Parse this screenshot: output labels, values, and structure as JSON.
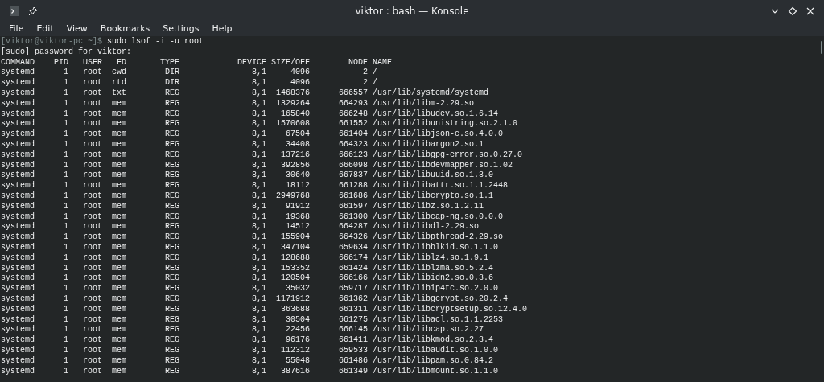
{
  "window": {
    "title": "viktor : bash — Konsole"
  },
  "menu": [
    "File",
    "Edit",
    "View",
    "Bookmarks",
    "Settings",
    "Help"
  ],
  "terminal": {
    "prompt": "[viktor@viktor-pc ~]$",
    "command": "sudo lsof -i -u root",
    "message": "[sudo] password for viktor:",
    "columns": [
      "COMMAND",
      "PID",
      "USER",
      "FD",
      "TYPE",
      "DEVICE",
      "SIZE/OFF",
      "NODE",
      "NAME"
    ],
    "rows": [
      [
        "systemd",
        "1",
        "root",
        "cwd",
        "DIR",
        "8,1",
        "4096",
        "2",
        "/"
      ],
      [
        "systemd",
        "1",
        "root",
        "rtd",
        "DIR",
        "8,1",
        "4096",
        "2",
        "/"
      ],
      [
        "systemd",
        "1",
        "root",
        "txt",
        "REG",
        "8,1",
        "1468376",
        "666557",
        "/usr/lib/systemd/systemd"
      ],
      [
        "systemd",
        "1",
        "root",
        "mem",
        "REG",
        "8,1",
        "1329264",
        "664293",
        "/usr/lib/libm-2.29.so"
      ],
      [
        "systemd",
        "1",
        "root",
        "mem",
        "REG",
        "8,1",
        "165840",
        "666248",
        "/usr/lib/libudev.so.1.6.14"
      ],
      [
        "systemd",
        "1",
        "root",
        "mem",
        "REG",
        "8,1",
        "1570608",
        "661552",
        "/usr/lib/libunistring.so.2.1.0"
      ],
      [
        "systemd",
        "1",
        "root",
        "mem",
        "REG",
        "8,1",
        "67504",
        "661404",
        "/usr/lib/libjson-c.so.4.0.0"
      ],
      [
        "systemd",
        "1",
        "root",
        "mem",
        "REG",
        "8,1",
        "34408",
        "664323",
        "/usr/lib/libargon2.so.1"
      ],
      [
        "systemd",
        "1",
        "root",
        "mem",
        "REG",
        "8,1",
        "137216",
        "666123",
        "/usr/lib/libgpg-error.so.0.27.0"
      ],
      [
        "systemd",
        "1",
        "root",
        "mem",
        "REG",
        "8,1",
        "392856",
        "666098",
        "/usr/lib/libdevmapper.so.1.02"
      ],
      [
        "systemd",
        "1",
        "root",
        "mem",
        "REG",
        "8,1",
        "30640",
        "667837",
        "/usr/lib/libuuid.so.1.3.0"
      ],
      [
        "systemd",
        "1",
        "root",
        "mem",
        "REG",
        "8,1",
        "18112",
        "661288",
        "/usr/lib/libattr.so.1.1.2448"
      ],
      [
        "systemd",
        "1",
        "root",
        "mem",
        "REG",
        "8,1",
        "2949768",
        "661686",
        "/usr/lib/libcrypto.so.1.1"
      ],
      [
        "systemd",
        "1",
        "root",
        "mem",
        "REG",
        "8,1",
        "91912",
        "661597",
        "/usr/lib/libz.so.1.2.11"
      ],
      [
        "systemd",
        "1",
        "root",
        "mem",
        "REG",
        "8,1",
        "19368",
        "661300",
        "/usr/lib/libcap-ng.so.0.0.0"
      ],
      [
        "systemd",
        "1",
        "root",
        "mem",
        "REG",
        "8,1",
        "14512",
        "664287",
        "/usr/lib/libdl-2.29.so"
      ],
      [
        "systemd",
        "1",
        "root",
        "mem",
        "REG",
        "8,1",
        "155904",
        "664326",
        "/usr/lib/libpthread-2.29.so"
      ],
      [
        "systemd",
        "1",
        "root",
        "mem",
        "REG",
        "8,1",
        "347104",
        "659634",
        "/usr/lib/libblkid.so.1.1.0"
      ],
      [
        "systemd",
        "1",
        "root",
        "mem",
        "REG",
        "8,1",
        "128688",
        "666174",
        "/usr/lib/liblz4.so.1.9.1"
      ],
      [
        "systemd",
        "1",
        "root",
        "mem",
        "REG",
        "8,1",
        "153352",
        "661424",
        "/usr/lib/liblzma.so.5.2.4"
      ],
      [
        "systemd",
        "1",
        "root",
        "mem",
        "REG",
        "8,1",
        "120504",
        "666166",
        "/usr/lib/libidn2.so.0.3.6"
      ],
      [
        "systemd",
        "1",
        "root",
        "mem",
        "REG",
        "8,1",
        "35032",
        "659717",
        "/usr/lib/libip4tc.so.2.0.0"
      ],
      [
        "systemd",
        "1",
        "root",
        "mem",
        "REG",
        "8,1",
        "1171912",
        "661362",
        "/usr/lib/libgcrypt.so.20.2.4"
      ],
      [
        "systemd",
        "1",
        "root",
        "mem",
        "REG",
        "8,1",
        "363688",
        "661311",
        "/usr/lib/libcryptsetup.so.12.4.0"
      ],
      [
        "systemd",
        "1",
        "root",
        "mem",
        "REG",
        "8,1",
        "30504",
        "661275",
        "/usr/lib/libacl.so.1.1.2253"
      ],
      [
        "systemd",
        "1",
        "root",
        "mem",
        "REG",
        "8,1",
        "22456",
        "666145",
        "/usr/lib/libcap.so.2.27"
      ],
      [
        "systemd",
        "1",
        "root",
        "mem",
        "REG",
        "8,1",
        "96176",
        "661411",
        "/usr/lib/libkmod.so.2.3.4"
      ],
      [
        "systemd",
        "1",
        "root",
        "mem",
        "REG",
        "8,1",
        "112312",
        "659533",
        "/usr/lib/libaudit.so.1.0.0"
      ],
      [
        "systemd",
        "1",
        "root",
        "mem",
        "REG",
        "8,1",
        "55048",
        "661486",
        "/usr/lib/libpam.so.0.84.2"
      ],
      [
        "systemd",
        "1",
        "root",
        "mem",
        "REG",
        "8,1",
        "387616",
        "661349",
        "/usr/lib/libmount.so.1.1.0"
      ]
    ]
  }
}
